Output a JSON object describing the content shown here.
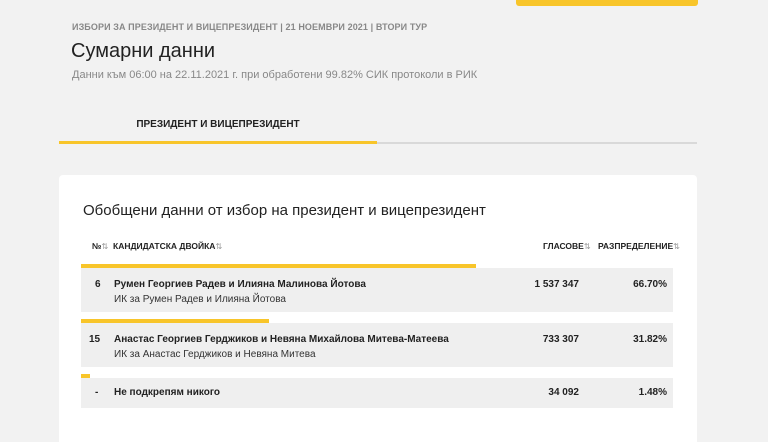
{
  "breadcrumb": "ИЗБОРИ ЗА ПРЕЗИДЕНТ И ВИЦЕПРЕЗИДЕНТ | 21 НОЕМВРИ 2021 | ВТОРИ ТУР",
  "page_title": "Сумарни данни",
  "subtitle": "Данни към 06:00 на 22.11.2021 г. при обработени 99.82% СИК протоколи в РИК",
  "tabs": [
    {
      "label": "ПРЕЗИДЕНТ И ВИЦЕПРЕЗИДЕНТ",
      "active": true
    }
  ],
  "accent_color": "#f8c52a",
  "card": {
    "title": "Обобщени данни от избор на президент и вицепрезидент",
    "headers": {
      "no": "№",
      "pair": "КАНДИДАТСКА ДВОЙКА",
      "votes": "ГЛАСОВЕ",
      "share": "РАЗПРЕДЕЛЕНИЕ"
    },
    "sort_icon": "⇅",
    "rows": [
      {
        "no": "6",
        "pair": "Румен Георгиев Радев и Илияна Малинова Йотова",
        "committee": "ИК за Румен Радев и Илияна Йотова",
        "votes": "1 537 347",
        "share": "66.70%",
        "share_value": 66.7
      },
      {
        "no": "15",
        "pair": "Анастас Георгиев Герджиков и Невяна Михайлова Митева-Матеева",
        "committee": "ИК за Анастас Герджиков и Невяна Митева",
        "votes": "733 307",
        "share": "31.82%",
        "share_value": 31.82
      },
      {
        "no": "-",
        "pair": "Не подкрепям никого",
        "committee": "",
        "votes": "34 092",
        "share": "1.48%",
        "share_value": 1.48
      }
    ]
  }
}
